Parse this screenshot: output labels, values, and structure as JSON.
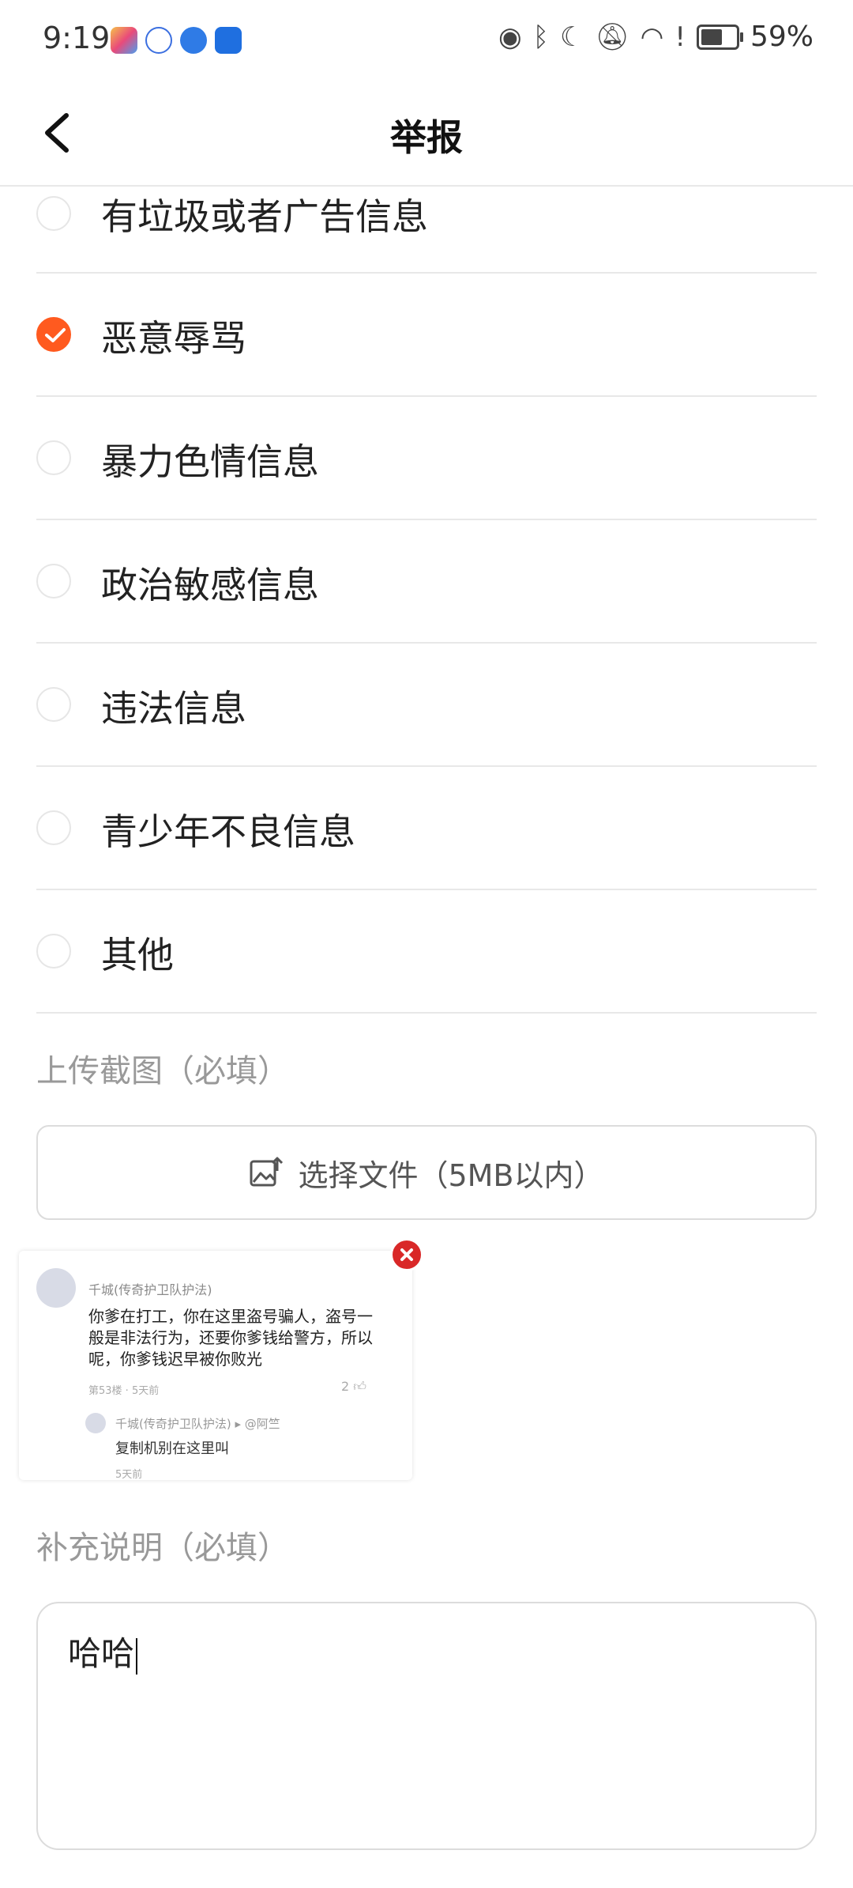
{
  "status_bar": {
    "time": "9:19",
    "battery": "59%",
    "icons": [
      "eye-icon",
      "bluetooth-icon",
      "moon-icon",
      "bell-off-icon",
      "wifi-icon",
      "alert-icon",
      "battery-icon"
    ]
  },
  "header": {
    "title": "举报"
  },
  "options": [
    {
      "label": "有垃圾或者广告信息",
      "checked": false
    },
    {
      "label": "恶意辱骂",
      "checked": true
    },
    {
      "label": "暴力色情信息",
      "checked": false
    },
    {
      "label": "政治敏感信息",
      "checked": false
    },
    {
      "label": "违法信息",
      "checked": false
    },
    {
      "label": "青少年不良信息",
      "checked": false
    },
    {
      "label": "其他",
      "checked": false
    }
  ],
  "upload": {
    "section_label": "上传截图（必填）",
    "button_label": "选择文件（5MB以内）"
  },
  "preview": {
    "name": "千城(传奇护卫队护法)",
    "content": "你爹在打工，你在这里盗号骗人，盗号一般是非法行为，还要你爹钱给警方，所以呢，你爹钱迟早被你败光",
    "meta": "第53楼 · 5天前",
    "likes": "2",
    "reply_name": "千城(传奇护卫队护法) ▸ @阿竺",
    "reply_text": "复制机别在这里叫",
    "reply_time": "5天前"
  },
  "supplement": {
    "section_label": "补充说明（必填）",
    "value": "哈哈"
  },
  "colors": {
    "accent": "#ff5a1f",
    "remove": "#d92828"
  }
}
